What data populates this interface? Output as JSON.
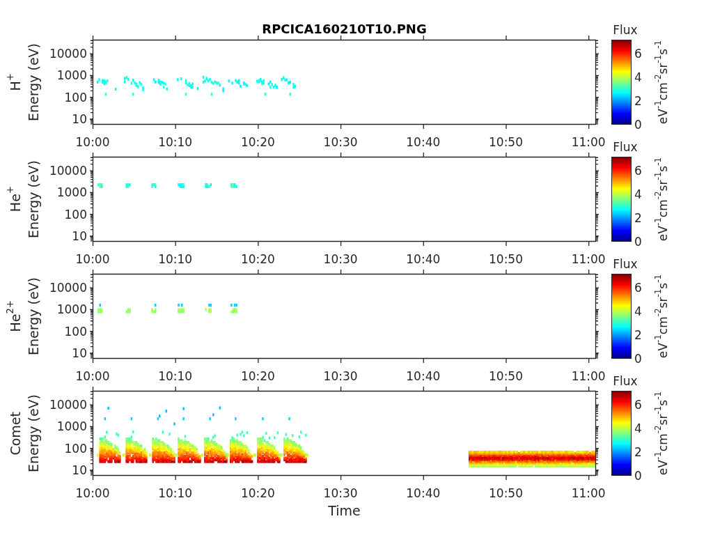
{
  "title": "RPCICA160210T10.PNG",
  "panels": [
    {
      "kind": "protons",
      "species": "H$^{+}$",
      "ylabel": "Energy (eV)",
      "yticks": [
        "10000",
        "1000",
        "100",
        "10"
      ],
      "xticks": [
        "10:00",
        "10:10",
        "10:20",
        "10:30",
        "10:40",
        "10:50",
        "11:00"
      ],
      "colorbar": {
        "title": "Flux",
        "ticks": [
          "6",
          "4",
          "2",
          "0"
        ],
        "label": "eV$^{-1}$cm$^{-2}$sr$^{-1}$s$^{-1}$"
      }
    },
    {
      "kind": "helium",
      "species": "He$^{+}$",
      "ylabel": "Energy (eV)",
      "yticks": [
        "10000",
        "1000",
        "100",
        "10"
      ],
      "xticks": [
        "10:00",
        "10:10",
        "10:20",
        "10:30",
        "10:40",
        "10:50",
        "11:00"
      ],
      "colorbar": {
        "title": "Flux",
        "ticks": [
          "6",
          "4",
          "2",
          "0"
        ],
        "label": "eV$^{-1}$cm$^{-2}$sr$^{-1}$s$^{-1}$"
      }
    },
    {
      "kind": "alpha",
      "species": "He$^{2+}$",
      "ylabel": "Energy (eV)",
      "yticks": [
        "10000",
        "1000",
        "100",
        "10"
      ],
      "xticks": [
        "10:00",
        "10:10",
        "10:20",
        "10:30",
        "10:40",
        "10:50",
        "11:00"
      ],
      "colorbar": {
        "title": "Flux",
        "ticks": [
          "6",
          "4",
          "2",
          "0"
        ],
        "label": "eV$^{-1}$cm$^{-2}$sr$^{-1}$s$^{-1}$"
      }
    },
    {
      "kind": "comet",
      "species": "Comet",
      "ylabel": "Energy (eV)",
      "yticks": [
        "10000",
        "1000",
        "100",
        "10"
      ],
      "xticks": [
        "10:00",
        "10:10",
        "10:20",
        "10:30",
        "10:40",
        "10:50",
        "11:00"
      ],
      "colorbar": {
        "title": "Flux",
        "ticks": [
          "6",
          "4",
          "2",
          "0"
        ],
        "label": "eV$^{-1}$cm$^{-2}$sr$^{-1}$s$^{-1}$"
      }
    }
  ],
  "xlabel": "Time"
}
